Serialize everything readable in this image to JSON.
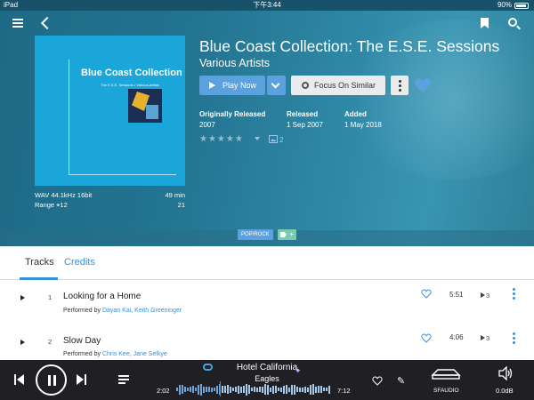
{
  "status_bar": {
    "device": "iPad",
    "time": "下午3:44",
    "battery": "90%",
    "battery_fraction": 0.9
  },
  "header": {
    "menu_icon": "hamburger-menu-icon",
    "back_icon": "chevron-left-icon",
    "bookmark_icon": "bookmark-icon",
    "search_icon": "search-icon"
  },
  "album": {
    "title": "Blue Coast Collection: The E.S.E. Sessions",
    "artist": "Various Artists",
    "cover": {
      "title": "Blue Coast Collection",
      "subtitle": "The E.S.E. Sessions • Various Artists"
    },
    "format": "WAV 44.1kHz 16bit",
    "duration": "49 min",
    "range": "Range ⌖12",
    "track_count": "21",
    "rating": 0,
    "image_count": "2",
    "genre": "POP/ROCK",
    "dates": [
      {
        "label": "Originally Released",
        "value": "2007"
      },
      {
        "label": "Released",
        "value": "1 Sep 2007"
      },
      {
        "label": "Added",
        "value": "1 May 2018"
      }
    ]
  },
  "actions": {
    "play_label": "Play Now",
    "focus_label": "Focus On Similar",
    "favorite": true
  },
  "tabs": [
    {
      "label": "Tracks",
      "active": true
    },
    {
      "label": "Credits",
      "active": false
    }
  ],
  "tracks": [
    {
      "number": "1",
      "title": "Looking for a Home",
      "performed_by_label": "Performed by",
      "performers": "Dayan Kai, Keith Greeninger",
      "duration": "5:51",
      "play_count": "3"
    },
    {
      "number": "2",
      "title": "Slow Day",
      "performed_by_label": "Performed by",
      "performers": "Chris Kee, Jane Selkye",
      "duration": "4:06",
      "play_count": "3"
    }
  ],
  "player": {
    "title": "Hotel California",
    "artist": "Eagles",
    "elapsed": "2:02",
    "total": "7:12",
    "device": "SFAUDIO",
    "volume": "0.0dB"
  },
  "colors": {
    "accent": "#3a8fd6",
    "hero": "#237491",
    "player_bg": "#1f1f24",
    "tag_add": "#7ccbb0"
  }
}
